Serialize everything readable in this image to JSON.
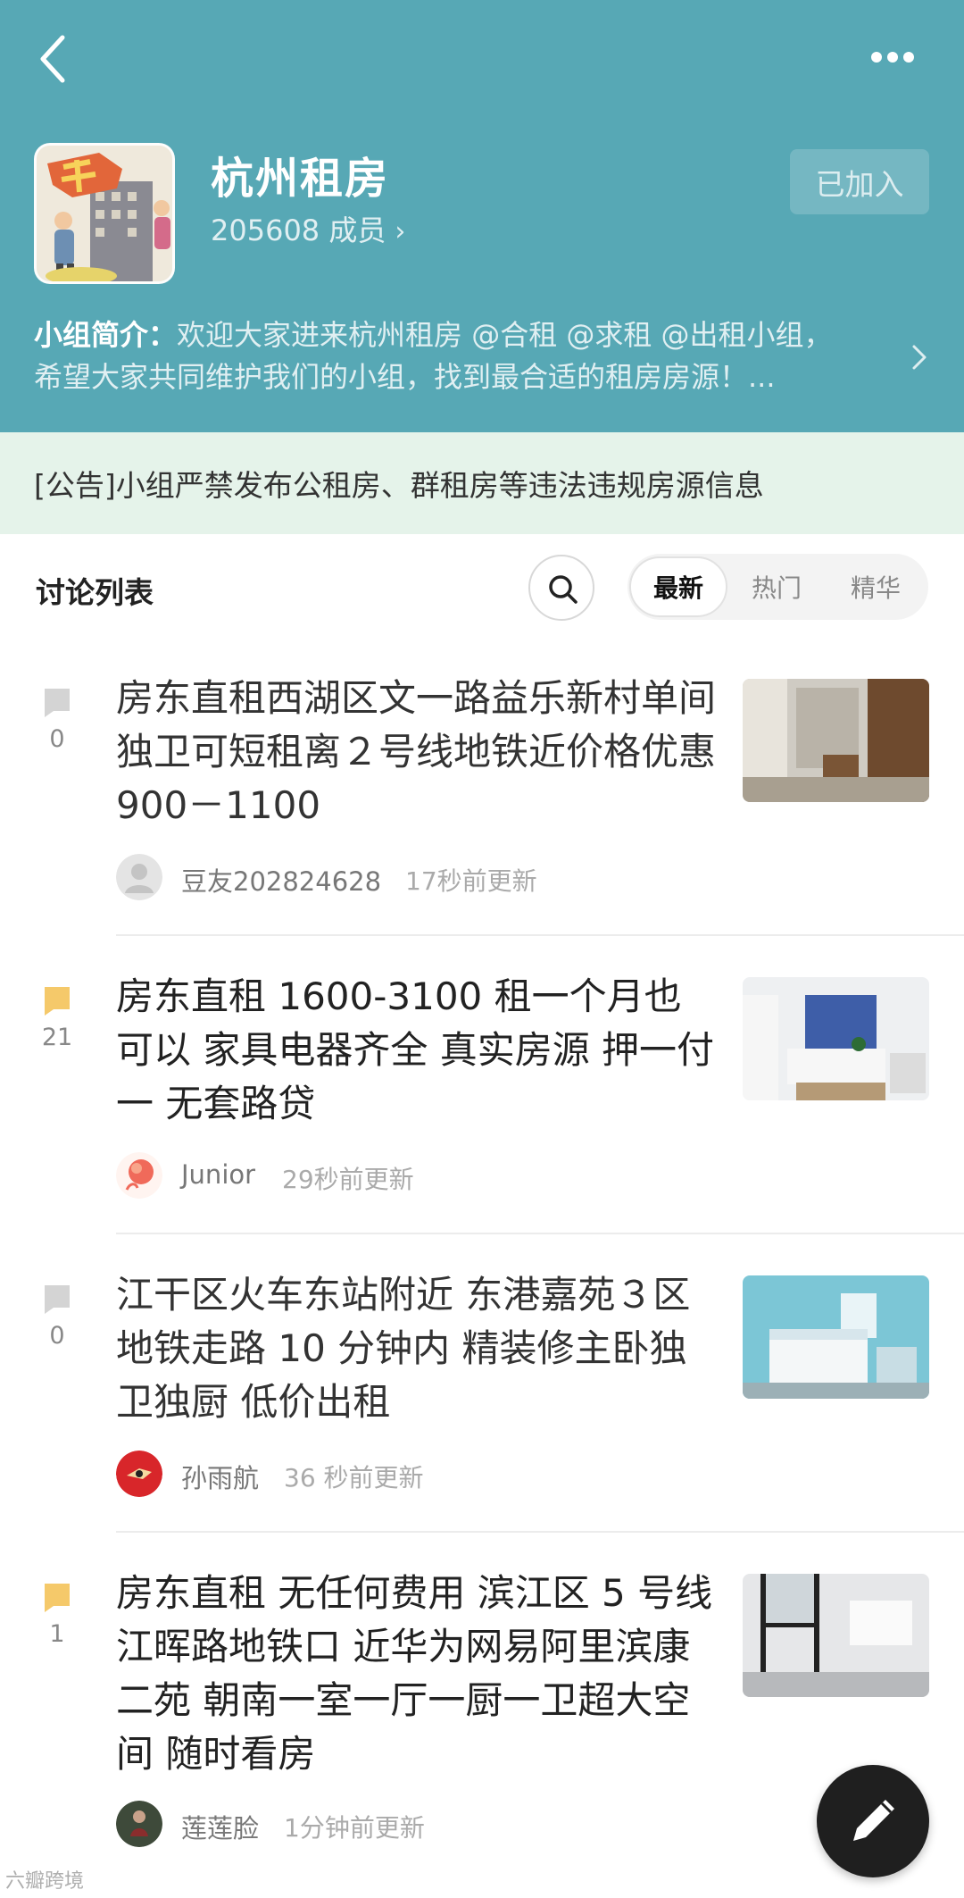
{
  "header": {
    "back_icon": "chevron-left-icon",
    "more_icon": "more-dots-icon",
    "group_name": "杭州租房",
    "member_count": "205608 成员",
    "member_chevron": "›",
    "joined_label": "已加入",
    "intro_label": "小组简介：",
    "intro_line1_rest": "欢迎大家进来杭州租房 @合租 @求租 @出租小组，",
    "intro_line2": "希望大家共同维护我们的小组，找到最合适的租房房源！...",
    "background_color": "#57a8b5"
  },
  "notice": {
    "text": "[公告]小组严禁发布公租房、群租房等违法违规房源信息"
  },
  "list": {
    "title": "讨论列表",
    "search_icon": "search-icon",
    "tabs": [
      "最新",
      "热门",
      "精华"
    ],
    "active_tab": "最新"
  },
  "posts": [
    {
      "title": "房东直租西湖区文一路益乐新村单间独卫可短租离２号线地铁近价格优惠 900－1100",
      "comments": "0",
      "author": "豆友202824628",
      "time": "17秒前更新",
      "read": true
    },
    {
      "title": "房东直租 1600-3100 租一个月也可以 家具电器齐全 真实房源 押一付一 无套路贷",
      "comments": "21",
      "author": "Junior",
      "time": "29秒前更新",
      "read": false
    },
    {
      "title": "江干区火车东站附近 东港嘉苑３区 地铁走路 10 分钟内 精装修主卧独卫独厨 低价出租",
      "comments": "0",
      "author": "孙雨航",
      "time": "36 秒前更新",
      "read": true
    },
    {
      "title": "房东直租 无任何费用 滨江区 5 号线 江晖路地铁口 近华为网易阿里滨康二苑 朝南一室一厅一厨一卫超大空间 随时看房",
      "comments": "1",
      "author": "莲莲脸",
      "time": "1分钟前更新",
      "read": false
    }
  ],
  "fab": {
    "icon": "pencil-icon"
  },
  "watermark": "六瓣跨境"
}
